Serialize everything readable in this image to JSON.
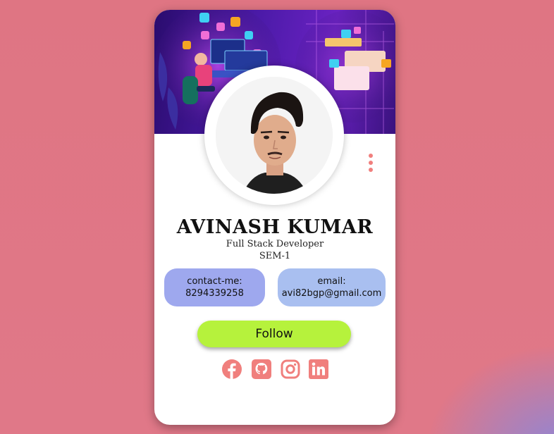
{
  "profile": {
    "name": "AVINASH KUMAR",
    "role": "Full Stack Developer",
    "semester": "SEM-1"
  },
  "contact": {
    "label": "contact-me:",
    "value": "8294339258"
  },
  "email": {
    "label": "email:",
    "value": "avi82bgp@gmail.com"
  },
  "follow_button": "Follow",
  "social_icons": [
    "facebook-icon",
    "github-icon",
    "instagram-icon",
    "linkedin-icon"
  ],
  "colors": {
    "accent_social": "#f07f7d",
    "follow_button": "#b6f23c",
    "contact_pill": "#9ea8ee",
    "email_pill": "#a9bff0"
  }
}
